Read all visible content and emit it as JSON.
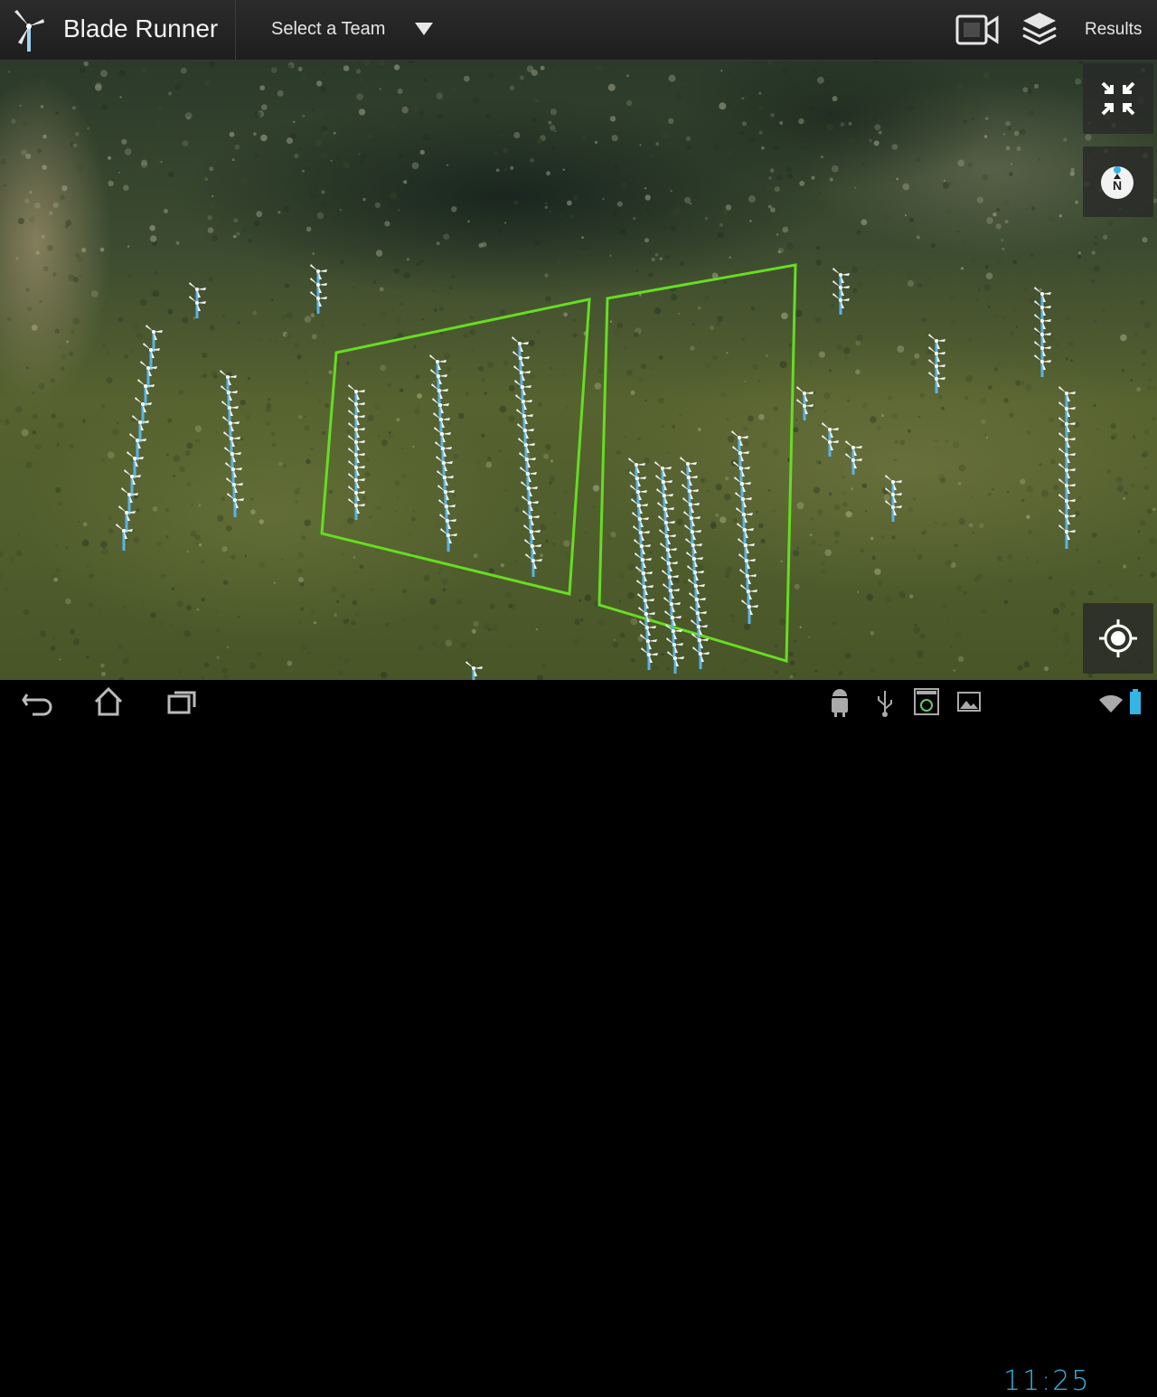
{
  "app": {
    "title": "Blade Runner",
    "icon": "wind-turbine-icon"
  },
  "team_select": {
    "label": "Select a Team",
    "icon": "dropdown-triangle-icon"
  },
  "actionbar": {
    "video_icon": "video-camera-icon",
    "layers_icon": "layers-icon",
    "results_label": "Results"
  },
  "map": {
    "type": "satellite",
    "controls": [
      "collapse-arrows-icon",
      "compass-icon",
      "my-location-icon"
    ],
    "zone_color": "#66dd22",
    "turbine_color": "#5ab4e8"
  },
  "statusbar": {
    "time": "11:25",
    "accent": "#33b5e5",
    "icons": [
      "android-debug-icon",
      "usb-icon",
      "screenshot-icon",
      "image-icon",
      "wifi-icon",
      "battery-icon"
    ]
  },
  "navbar": {
    "buttons": [
      "back-icon",
      "home-icon",
      "recent-apps-icon"
    ]
  }
}
